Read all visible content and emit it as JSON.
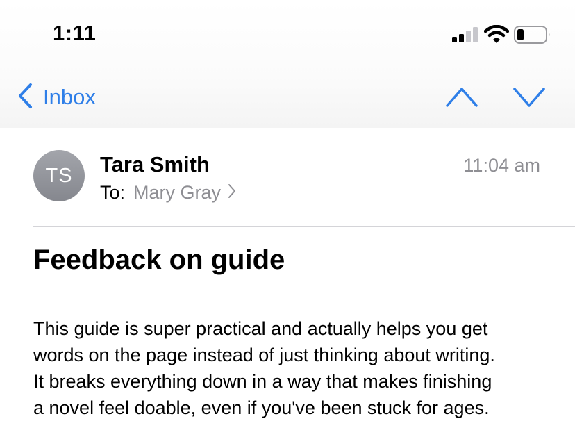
{
  "status_bar": {
    "time": "1:11",
    "icons": [
      "cellular-signal-icon",
      "wifi-icon",
      "battery-icon"
    ]
  },
  "nav": {
    "back_label": "Inbox",
    "icons": [
      "chevron-left-icon",
      "chevron-up-icon",
      "chevron-down-icon"
    ],
    "accent_color": "#2f7fe8"
  },
  "message": {
    "avatar_initials": "TS",
    "sender": "Tara Smith",
    "to_label": "To:",
    "recipient": "Mary Gray",
    "timestamp": "11:04 am",
    "subject": "Feedback on guide",
    "body_lines": [
      "This guide is super practical and actually helps you get",
      "words on the page instead of just thinking about writing.",
      "It breaks everything down in a way that makes finishing",
      "a novel feel doable, even if you've been stuck for ages."
    ]
  }
}
